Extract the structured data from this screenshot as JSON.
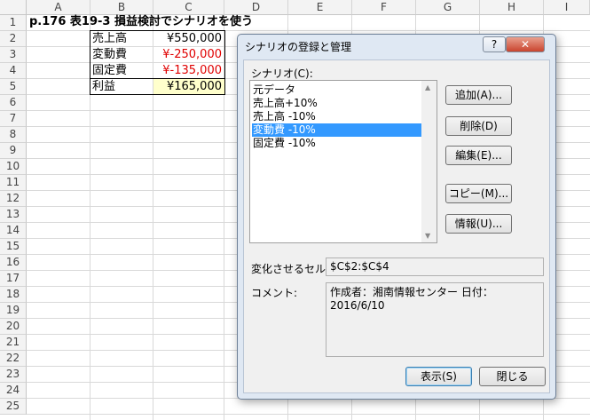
{
  "sheet": {
    "columns": [
      "A",
      "B",
      "C",
      "D",
      "E",
      "F",
      "G",
      "H",
      "I"
    ],
    "rows": [
      "1",
      "2",
      "3",
      "4",
      "5",
      "6",
      "7",
      "8",
      "9",
      "10",
      "11",
      "12",
      "13",
      "14",
      "15",
      "16",
      "17",
      "18",
      "19",
      "20",
      "21",
      "22",
      "23",
      "24",
      "25"
    ],
    "title": "p.176  表19-3  損益検討でシナリオを使う",
    "table": [
      {
        "label": "売上高",
        "value": "¥550,000",
        "negative": false
      },
      {
        "label": "変動費",
        "value": "¥-250,000",
        "negative": true
      },
      {
        "label": "固定費",
        "value": "¥-135,000",
        "negative": true
      },
      {
        "label": "利益",
        "value": "¥165,000",
        "negative": false
      }
    ]
  },
  "dialog": {
    "title": "シナリオの登録と管理",
    "help_label": "?",
    "close_label": "✕",
    "scenario_label": "シナリオ(C):",
    "scenarios": [
      {
        "name": "元データ",
        "selected": false
      },
      {
        "name": "売上高+10%",
        "selected": false
      },
      {
        "name": "売上高 -10%",
        "selected": false
      },
      {
        "name": "変動費 -10%",
        "selected": true
      },
      {
        "name": "固定費 -10%",
        "selected": false
      }
    ],
    "buttons": {
      "add": "追加(A)...",
      "delete": "削除(D)",
      "edit": "編集(E)...",
      "copy": "コピー(M)...",
      "info": "情報(U)..."
    },
    "changing_cells_label": "変化させるセル:",
    "changing_cells_value": "$C$2:$C$4",
    "comment_label": "コメント:",
    "comment_value": "作成者：湘南情報センター 日付：2016/6/10",
    "show_label": "表示(S)",
    "close_button_label": "閉じる"
  }
}
